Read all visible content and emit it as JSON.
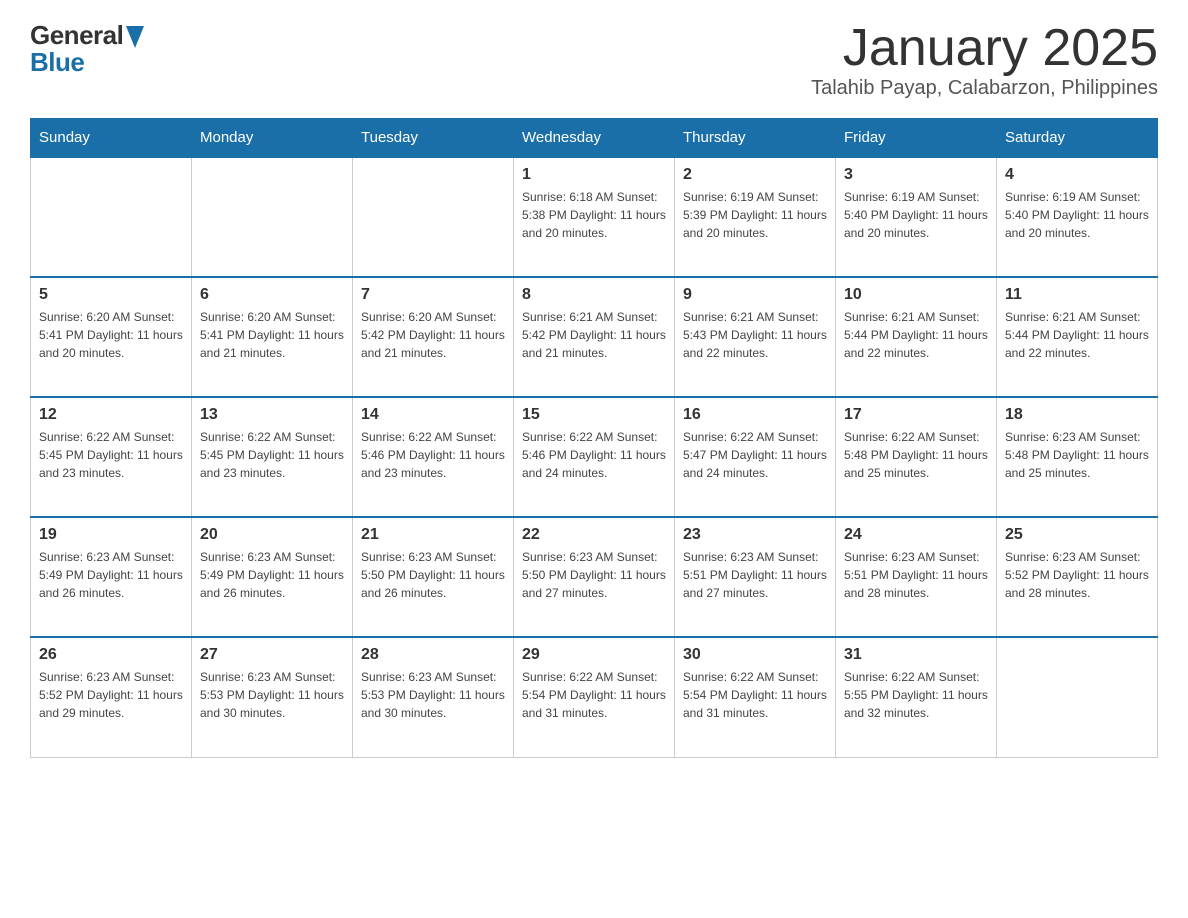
{
  "header": {
    "logo_line1": "General",
    "logo_line2": "Blue",
    "title": "January 2025",
    "subtitle": "Talahib Payap, Calabarzon, Philippines"
  },
  "calendar": {
    "days_of_week": [
      "Sunday",
      "Monday",
      "Tuesday",
      "Wednesday",
      "Thursday",
      "Friday",
      "Saturday"
    ],
    "weeks": [
      [
        {
          "day": "",
          "info": ""
        },
        {
          "day": "",
          "info": ""
        },
        {
          "day": "",
          "info": ""
        },
        {
          "day": "1",
          "info": "Sunrise: 6:18 AM\nSunset: 5:38 PM\nDaylight: 11 hours\nand 20 minutes."
        },
        {
          "day": "2",
          "info": "Sunrise: 6:19 AM\nSunset: 5:39 PM\nDaylight: 11 hours\nand 20 minutes."
        },
        {
          "day": "3",
          "info": "Sunrise: 6:19 AM\nSunset: 5:40 PM\nDaylight: 11 hours\nand 20 minutes."
        },
        {
          "day": "4",
          "info": "Sunrise: 6:19 AM\nSunset: 5:40 PM\nDaylight: 11 hours\nand 20 minutes."
        }
      ],
      [
        {
          "day": "5",
          "info": "Sunrise: 6:20 AM\nSunset: 5:41 PM\nDaylight: 11 hours\nand 20 minutes."
        },
        {
          "day": "6",
          "info": "Sunrise: 6:20 AM\nSunset: 5:41 PM\nDaylight: 11 hours\nand 21 minutes."
        },
        {
          "day": "7",
          "info": "Sunrise: 6:20 AM\nSunset: 5:42 PM\nDaylight: 11 hours\nand 21 minutes."
        },
        {
          "day": "8",
          "info": "Sunrise: 6:21 AM\nSunset: 5:42 PM\nDaylight: 11 hours\nand 21 minutes."
        },
        {
          "day": "9",
          "info": "Sunrise: 6:21 AM\nSunset: 5:43 PM\nDaylight: 11 hours\nand 22 minutes."
        },
        {
          "day": "10",
          "info": "Sunrise: 6:21 AM\nSunset: 5:44 PM\nDaylight: 11 hours\nand 22 minutes."
        },
        {
          "day": "11",
          "info": "Sunrise: 6:21 AM\nSunset: 5:44 PM\nDaylight: 11 hours\nand 22 minutes."
        }
      ],
      [
        {
          "day": "12",
          "info": "Sunrise: 6:22 AM\nSunset: 5:45 PM\nDaylight: 11 hours\nand 23 minutes."
        },
        {
          "day": "13",
          "info": "Sunrise: 6:22 AM\nSunset: 5:45 PM\nDaylight: 11 hours\nand 23 minutes."
        },
        {
          "day": "14",
          "info": "Sunrise: 6:22 AM\nSunset: 5:46 PM\nDaylight: 11 hours\nand 23 minutes."
        },
        {
          "day": "15",
          "info": "Sunrise: 6:22 AM\nSunset: 5:46 PM\nDaylight: 11 hours\nand 24 minutes."
        },
        {
          "day": "16",
          "info": "Sunrise: 6:22 AM\nSunset: 5:47 PM\nDaylight: 11 hours\nand 24 minutes."
        },
        {
          "day": "17",
          "info": "Sunrise: 6:22 AM\nSunset: 5:48 PM\nDaylight: 11 hours\nand 25 minutes."
        },
        {
          "day": "18",
          "info": "Sunrise: 6:23 AM\nSunset: 5:48 PM\nDaylight: 11 hours\nand 25 minutes."
        }
      ],
      [
        {
          "day": "19",
          "info": "Sunrise: 6:23 AM\nSunset: 5:49 PM\nDaylight: 11 hours\nand 26 minutes."
        },
        {
          "day": "20",
          "info": "Sunrise: 6:23 AM\nSunset: 5:49 PM\nDaylight: 11 hours\nand 26 minutes."
        },
        {
          "day": "21",
          "info": "Sunrise: 6:23 AM\nSunset: 5:50 PM\nDaylight: 11 hours\nand 26 minutes."
        },
        {
          "day": "22",
          "info": "Sunrise: 6:23 AM\nSunset: 5:50 PM\nDaylight: 11 hours\nand 27 minutes."
        },
        {
          "day": "23",
          "info": "Sunrise: 6:23 AM\nSunset: 5:51 PM\nDaylight: 11 hours\nand 27 minutes."
        },
        {
          "day": "24",
          "info": "Sunrise: 6:23 AM\nSunset: 5:51 PM\nDaylight: 11 hours\nand 28 minutes."
        },
        {
          "day": "25",
          "info": "Sunrise: 6:23 AM\nSunset: 5:52 PM\nDaylight: 11 hours\nand 28 minutes."
        }
      ],
      [
        {
          "day": "26",
          "info": "Sunrise: 6:23 AM\nSunset: 5:52 PM\nDaylight: 11 hours\nand 29 minutes."
        },
        {
          "day": "27",
          "info": "Sunrise: 6:23 AM\nSunset: 5:53 PM\nDaylight: 11 hours\nand 30 minutes."
        },
        {
          "day": "28",
          "info": "Sunrise: 6:23 AM\nSunset: 5:53 PM\nDaylight: 11 hours\nand 30 minutes."
        },
        {
          "day": "29",
          "info": "Sunrise: 6:22 AM\nSunset: 5:54 PM\nDaylight: 11 hours\nand 31 minutes."
        },
        {
          "day": "30",
          "info": "Sunrise: 6:22 AM\nSunset: 5:54 PM\nDaylight: 11 hours\nand 31 minutes."
        },
        {
          "day": "31",
          "info": "Sunrise: 6:22 AM\nSunset: 5:55 PM\nDaylight: 11 hours\nand 32 minutes."
        },
        {
          "day": "",
          "info": ""
        }
      ]
    ]
  },
  "colors": {
    "header_bg": "#1a6fa8",
    "header_text": "#ffffff",
    "border": "#cccccc",
    "accent_blue": "#1a6fa8"
  }
}
